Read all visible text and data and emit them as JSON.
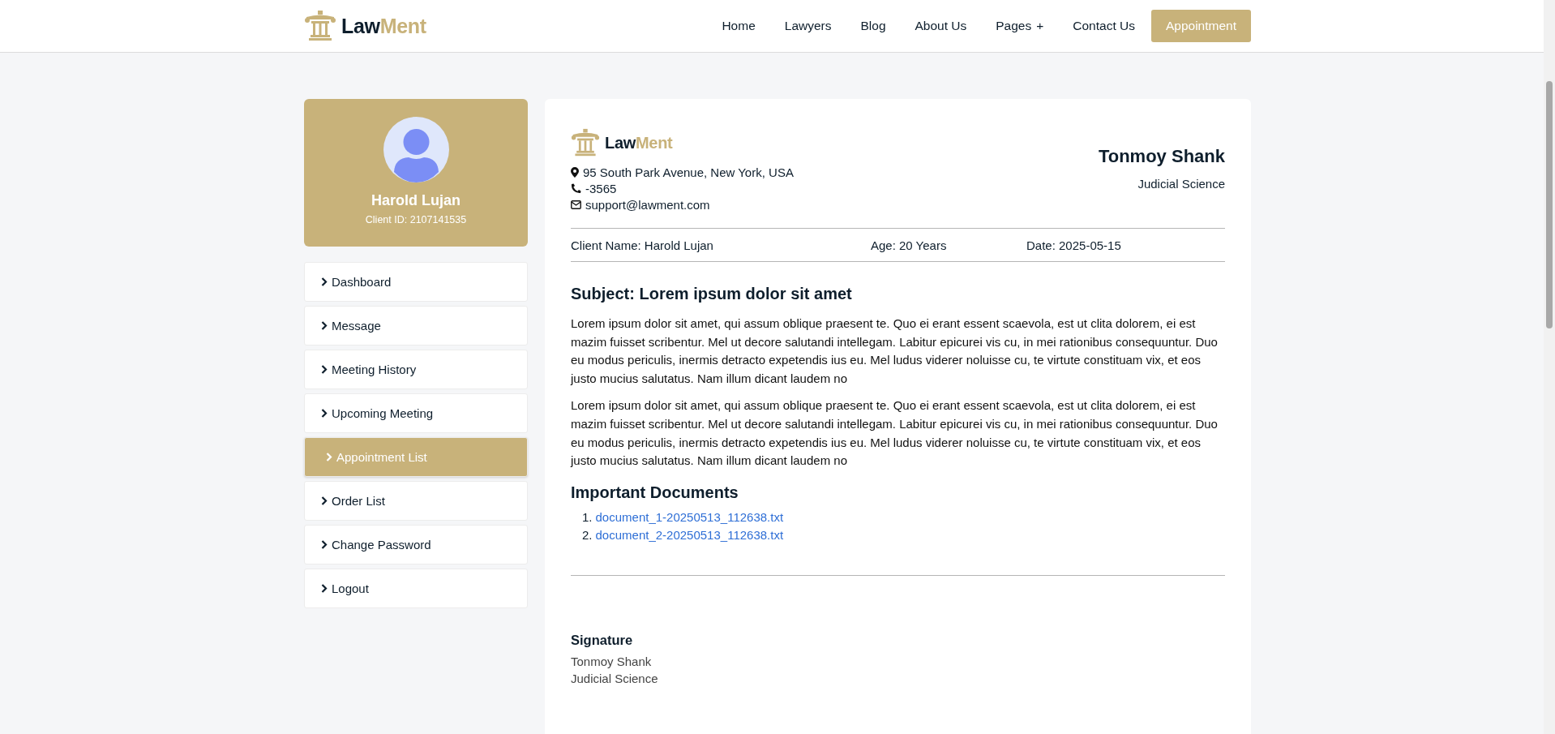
{
  "header": {
    "logo": {
      "first": "Law",
      "second": "Ment"
    },
    "nav": [
      {
        "label": "Home"
      },
      {
        "label": "Lawyers"
      },
      {
        "label": "Blog"
      },
      {
        "label": "About Us"
      },
      {
        "label": "Pages",
        "suffix": "+"
      },
      {
        "label": "Contact Us"
      }
    ],
    "cta": "Appointment"
  },
  "profile": {
    "name": "Harold Lujan",
    "client_id": "Client ID: 2107141535"
  },
  "menu": [
    {
      "label": "Dashboard",
      "selected": false
    },
    {
      "label": "Message",
      "selected": false
    },
    {
      "label": "Meeting History",
      "selected": false
    },
    {
      "label": "Upcoming Meeting",
      "selected": false
    },
    {
      "label": "Appointment List",
      "selected": true
    },
    {
      "label": "Order List",
      "selected": false
    },
    {
      "label": "Change Password",
      "selected": false
    },
    {
      "label": "Logout",
      "selected": false
    }
  ],
  "letter": {
    "logo": {
      "first": "Law",
      "second": "Ment"
    },
    "address": "95 South Park Avenue, New York, USA",
    "phone": "-3565",
    "email": "support@lawment.com",
    "lawyer_name": "Tonmoy Shank",
    "lawyer_title": "Judicial Science",
    "client_name": "Client Name: Harold Lujan",
    "age": "Age: 20 Years",
    "date": "Date: 2025-05-15",
    "subject": "Subject: Lorem ipsum dolor sit amet",
    "paragraphs": [
      "Lorem ipsum dolor sit amet, qui assum oblique praesent te. Quo ei erant essent scaevola, est ut clita dolorem, ei est mazim fuisset scribentur. Mel ut decore salutandi intellegam. Labitur epicurei vis cu, in mei rationibus consequuntur. Duo eu modus periculis, inermis detracto expetendis ius eu. Mel ludus viderer noluisse cu, te virtute constituam vix, et eos justo mucius salutatus. Nam illum dicant laudem no",
      "Lorem ipsum dolor sit amet, qui assum oblique praesent te. Quo ei erant essent scaevola, est ut clita dolorem, ei est mazim fuisset scribentur. Mel ut decore salutandi intellegam. Labitur epicurei vis cu, in mei rationibus consequuntur. Duo eu modus periculis, inermis detracto expetendis ius eu. Mel ludus viderer noluisse cu, te virtute constituam vix, et eos justo mucius salutatus. Nam illum dicant laudem no"
    ],
    "documents_title": "Important Documents",
    "documents": [
      {
        "number": "1.",
        "file": "document_1-20250513_112638.txt"
      },
      {
        "number": "2.",
        "file": "document_2-20250513_112638.txt"
      }
    ],
    "signature_title": "Signature",
    "signature_name": "Tonmoy Shank",
    "signature_title_line": "Judicial Science"
  }
}
